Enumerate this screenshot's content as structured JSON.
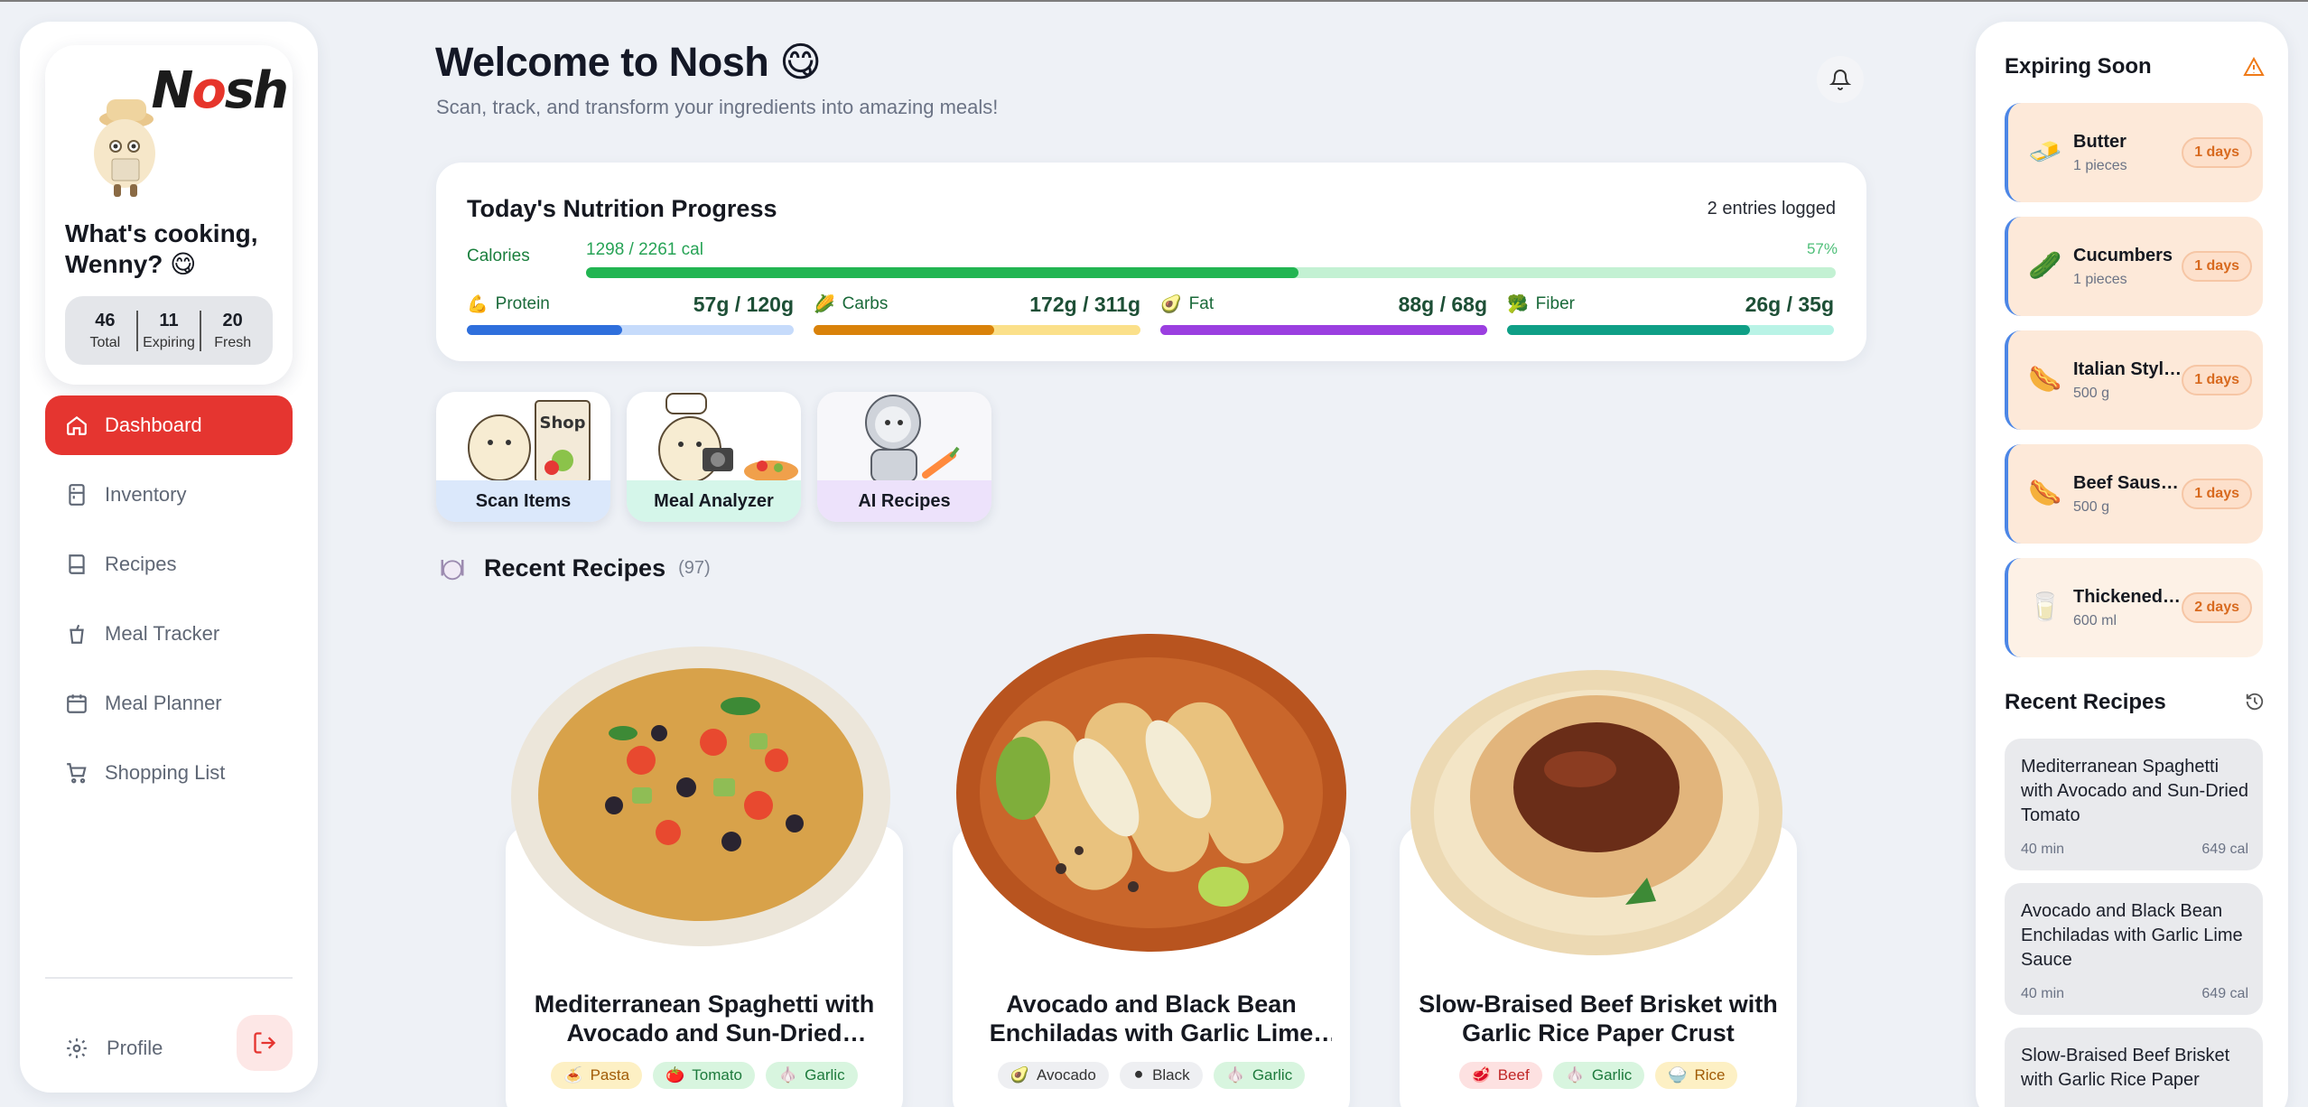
{
  "app": {
    "logo": "Nosh"
  },
  "sidebar": {
    "greeting": "What's cooking, Wenny? 😋",
    "stats": [
      {
        "value": "46",
        "label": "Total"
      },
      {
        "value": "11",
        "label": "Expiring"
      },
      {
        "value": "20",
        "label": "Fresh"
      }
    ],
    "nav": [
      {
        "label": "Dashboard",
        "icon": "home-icon",
        "active": true
      },
      {
        "label": "Inventory",
        "icon": "fridge-icon"
      },
      {
        "label": "Recipes",
        "icon": "book-icon"
      },
      {
        "label": "Meal Tracker",
        "icon": "cup-icon"
      },
      {
        "label": "Meal Planner",
        "icon": "calendar-icon"
      },
      {
        "label": "Shopping List",
        "icon": "cart-icon"
      }
    ],
    "profile_label": "Profile"
  },
  "header": {
    "title": "Welcome to Nosh 😋",
    "subtitle": "Scan, track, and transform your ingredients into amazing meals!"
  },
  "nutrition": {
    "title": "Today's Nutrition Progress",
    "entries": "2 entries logged",
    "calories": {
      "label": "Calories",
      "value": "1298 / 2261 cal",
      "percent": "57%",
      "fraction": 0.57
    },
    "macros": [
      {
        "icon": "💪",
        "name": "Protein",
        "value": "57g / 120g",
        "fraction": 0.475,
        "color": "#2f6fdc",
        "track": "#c6dbfb"
      },
      {
        "icon": "🌽",
        "name": "Carbs",
        "value": "172g / 311g",
        "fraction": 0.553,
        "color": "#d9820a",
        "track": "#fbe08a"
      },
      {
        "icon": "🥑",
        "name": "Fat",
        "value": "88g / 68g",
        "fraction": 1.0,
        "color": "#9b3fe0",
        "track": "#e5cffa"
      },
      {
        "icon": "🥦",
        "name": "Fiber",
        "value": "26g / 35g",
        "fraction": 0.743,
        "color": "#0f9f86",
        "track": "#b9f3e6"
      }
    ]
  },
  "tiles": [
    {
      "label": "Scan Items",
      "color": "#dbe8fb"
    },
    {
      "label": "Meal Analyzer",
      "color": "#d5f6ea"
    },
    {
      "label": "AI Recipes",
      "color": "#ede2fb"
    }
  ],
  "recent_recipes": {
    "title": "Recent Recipes",
    "count": "(97)",
    "items": [
      {
        "title": "Mediterranean Spaghetti with Avocado and Sun-Dried Tomato",
        "tags": [
          {
            "icon": "🍝",
            "label": "Pasta",
            "bg": "#fdf0c4",
            "fg": "#a15c07"
          },
          {
            "icon": "🍅",
            "label": "Tomato",
            "bg": "#d8f5df",
            "fg": "#1d7a3c"
          },
          {
            "icon": "🧄",
            "label": "Garlic",
            "bg": "#d8f5df",
            "fg": "#1d7a3c"
          }
        ]
      },
      {
        "title": "Avocado and Black Bean Enchiladas with Garlic Lime Sauce",
        "tags": [
          {
            "icon": "🥑",
            "label": "Avocado",
            "bg": "#eeeff2",
            "fg": "#333"
          },
          {
            "icon": "⚫",
            "label": "Black",
            "bg": "#eeeff2",
            "fg": "#333"
          },
          {
            "icon": "🧄",
            "label": "Garlic",
            "bg": "#d8f5df",
            "fg": "#1d7a3c"
          }
        ]
      },
      {
        "title": "Slow-Braised Beef Brisket with Garlic Rice Paper Crust",
        "tags": [
          {
            "icon": "🥩",
            "label": "Beef",
            "bg": "#fde1e1",
            "fg": "#c02626"
          },
          {
            "icon": "🧄",
            "label": "Garlic",
            "bg": "#d8f5df",
            "fg": "#1d7a3c"
          },
          {
            "icon": "🍚",
            "label": "Rice",
            "bg": "#fdf0c4",
            "fg": "#a15c07"
          }
        ]
      }
    ]
  },
  "expiring": {
    "title": "Expiring Soon",
    "items": [
      {
        "name": "Butter",
        "qty": "1 pieces",
        "days": "1 days",
        "icon": "🧈"
      },
      {
        "name": "Cucumbers",
        "qty": "1 pieces",
        "days": "1 days",
        "icon": "🥒"
      },
      {
        "name": "Italian Style Sausage",
        "qty": "500 g",
        "days": "1 days",
        "icon": "🌭"
      },
      {
        "name": "Beef Sausage",
        "qty": "500 g",
        "days": "1 days",
        "icon": "🌭"
      },
      {
        "name": "Thickened Cream",
        "qty": "600 ml",
        "days": "2 days",
        "icon": "🥛"
      }
    ]
  },
  "side_recent": {
    "title": "Recent Recipes",
    "items": [
      {
        "name": "Mediterranean Spaghetti with Avocado and Sun-Dried Tomato",
        "time": "40 min",
        "cal": "649 cal"
      },
      {
        "name": "Avocado and Black Bean Enchiladas with Garlic Lime Sauce",
        "time": "40 min",
        "cal": "649 cal"
      },
      {
        "name": "Slow-Braised Beef Brisket with Garlic Rice Paper",
        "time": "",
        "cal": ""
      }
    ]
  }
}
